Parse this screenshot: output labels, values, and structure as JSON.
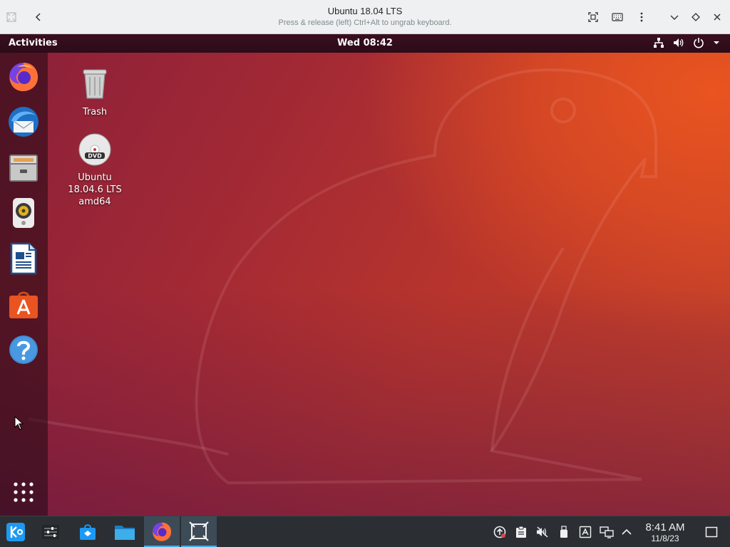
{
  "vm_window": {
    "title": "Ubuntu 18.04 LTS",
    "subtitle": "Press & release (left) Ctrl+Alt to ungrab keyboard."
  },
  "gnome_topbar": {
    "activities": "Activities",
    "clock": "Wed 08:42",
    "status_icons": [
      "network-icon",
      "volume-icon",
      "power-icon",
      "dropdown-arrow-icon"
    ]
  },
  "dock": {
    "items": [
      "firefox-icon",
      "thunderbird-icon",
      "files-icon",
      "rhythmbox-icon",
      "libreoffice-writer-icon",
      "ubuntu-software-icon",
      "help-icon"
    ],
    "show_apps": "show-applications-icon"
  },
  "desktop": {
    "icons": [
      {
        "label": "Trash",
        "icon": "trash-icon"
      },
      {
        "label": "Ubuntu 18.04.6 LTS amd64",
        "icon": "dvd-icon"
      }
    ]
  },
  "kde_panel": {
    "tasks": [
      "kde-menu-icon",
      "settings-sliders-icon",
      "discover-icon",
      "folder-icon",
      "firefox-icon",
      "vm-viewer-icon"
    ],
    "tray": [
      "update-icon",
      "clipboard-icon",
      "muted-volume-icon",
      "usb-icon",
      "notes-icon",
      "network-icon",
      "expand-arrow-icon"
    ],
    "time": "8:41 AM",
    "date": "11/8/23"
  },
  "colors": {
    "ubuntu_orange": "#e95420",
    "aubergine": "#2c0b18",
    "kde_panel": "#2b2f33",
    "kde_accent": "#3daee9"
  }
}
